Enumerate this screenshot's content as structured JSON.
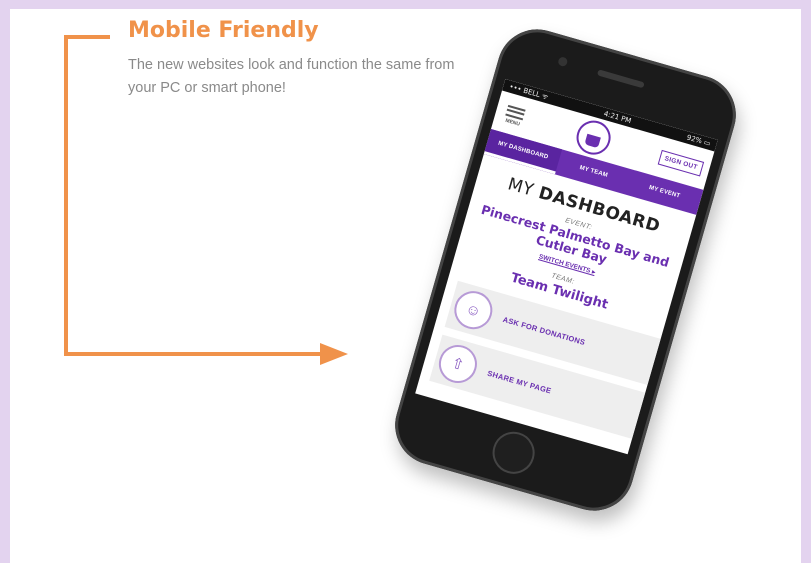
{
  "promo": {
    "headline": "Mobile Friendly",
    "description": "The new websites look and function the same from your PC or smart phone!"
  },
  "phone": {
    "status_bar": {
      "carrier": "••• BELL ᯤ",
      "time": "4:21 PM",
      "battery": "92% ▭"
    },
    "menu_label": "MENU",
    "sign_out_label": "SIGN OUT",
    "nav_tabs": [
      {
        "label": "MY DASHBOARD",
        "active": true
      },
      {
        "label": "MY TEAM",
        "active": false
      },
      {
        "label": "MY EVENT",
        "active": false
      }
    ],
    "dashboard": {
      "title_light": "MY ",
      "title_bold": "DASHBOARD",
      "event_label": "EVENT:",
      "event_name": "Pinecrest Palmetto Bay and Cutler Bay",
      "switch_events": "SWITCH EVENTS ▸",
      "team_label": "TEAM:",
      "team_name": "Team Twilight"
    },
    "actions": [
      {
        "label": "ASK FOR DONATIONS",
        "icon": "person-plus-icon"
      },
      {
        "label": "SHARE MY PAGE",
        "icon": "share-icon"
      }
    ]
  },
  "colors": {
    "accent_orange": "#f0924a",
    "brand_purple": "#6a2fb0",
    "page_border": "#e3d3ef"
  }
}
